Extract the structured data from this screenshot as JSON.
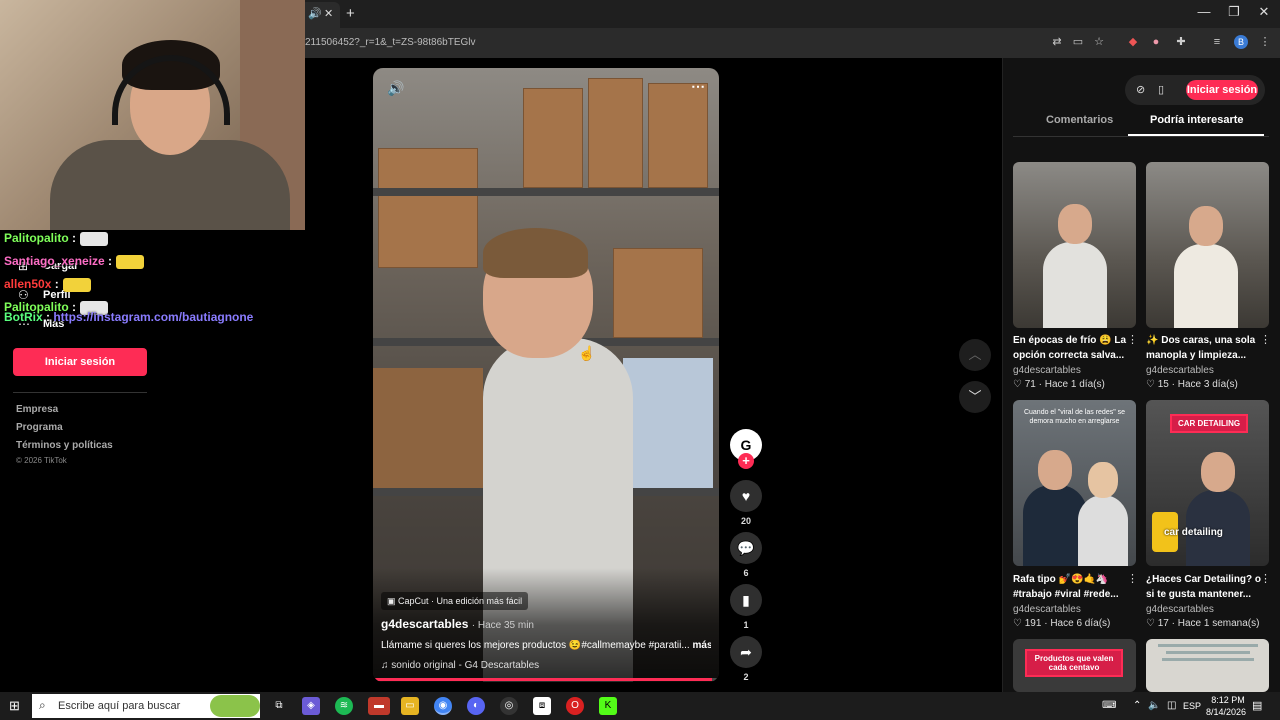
{
  "browser": {
    "url": "211506452?_r=1&_t=ZS-98t86bTEGlv",
    "tab_icons": {
      "audio": "🔊",
      "close": "✕"
    },
    "new_tab": "+",
    "window_controls": {
      "minimize": "—",
      "restore": "❐",
      "close": "✕"
    },
    "profile_initial": "B"
  },
  "sidebar": {
    "items": [
      {
        "label": "Cargar",
        "icon": "upload-icon"
      },
      {
        "label": "Perfil",
        "icon": "profile-icon"
      },
      {
        "label": "Más",
        "icon": "more-icon"
      }
    ],
    "login_label": "Iniciar sesión",
    "footer_links": [
      "Empresa",
      "Programa",
      "Términos y políticas"
    ],
    "copyright": "© 2026 TikTok"
  },
  "chat": [
    {
      "user": "Palitopalito",
      "text": "",
      "color": "#7fff5a"
    },
    {
      "user": "Santiago_xeneize",
      "text": "",
      "color": "#ff6ec7"
    },
    {
      "user": "allen50x",
      "text": "",
      "color": "#ff3b3b"
    },
    {
      "user": "Palitopalito",
      "text": "",
      "color": "#7fff5a"
    },
    {
      "user": "BotRix",
      "text": "https://instagram.com/bautiagnone",
      "color": "#5aff7f"
    }
  ],
  "video": {
    "capcut_label": "CapCut · Una edición más fácil",
    "author": "g4descartables",
    "posted": "· Hace 35 min",
    "caption": "Llámame si queres los mejores productos 😉#callmemaybe #paratii...",
    "more_label": "más",
    "sound": "sonido original - G4 Descartables",
    "progress_fraction": 0.98
  },
  "actions": {
    "likes": "20",
    "comments": "6",
    "saves": "1",
    "shares": "2"
  },
  "right_panel": {
    "login_label": "Iniciar sesión",
    "tabs": [
      "Comentarios",
      "Podría interesarte"
    ],
    "active_tab": 1,
    "cards": [
      {
        "title": "En épocas de frío 😩 La opción correcta salva...",
        "author": "g4descartables",
        "likes": "71",
        "age": "Hace 1 día(s)"
      },
      {
        "title": "✨ Dos caras, una sola manopla y limpieza...",
        "author": "g4descartables",
        "likes": "15",
        "age": "Hace 3 día(s)"
      },
      {
        "title": "Rafa tipo 💅😍🤙🦄 #trabajo #viral #rede...",
        "author": "g4descartables",
        "likes": "191",
        "age": "Hace 6 día(s)",
        "overlay": "Cuando el \"viral de las redes\" se demora mucho en arreglarse"
      },
      {
        "title": "¿Haces Car Detailing? o si te gusta mantener...",
        "author": "g4descartables",
        "likes": "17",
        "age": "Hace 1 semana(s)",
        "badge": "CAR DETAILING",
        "overlay": "car detailing"
      },
      {
        "badge": "Productos que valen cada centavo"
      },
      {
        "overlay": ""
      }
    ]
  },
  "taskbar": {
    "search_placeholder": "Escribe aquí para buscar",
    "language": "ESP",
    "time": "8:12 PM",
    "date": "8/14/2026"
  }
}
